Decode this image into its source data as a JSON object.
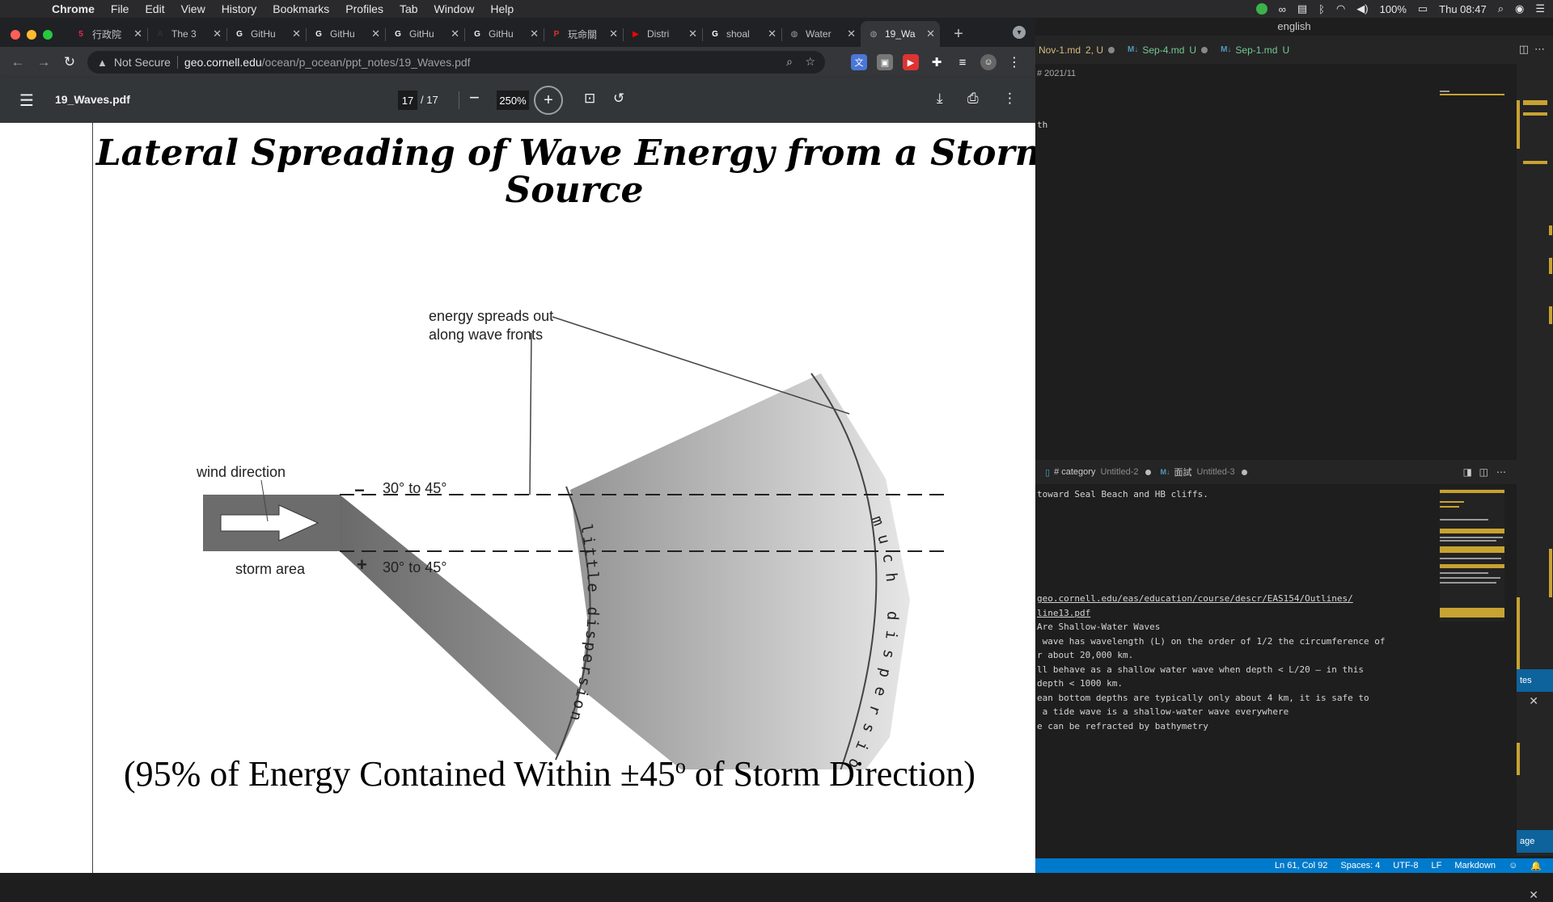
{
  "menubar": {
    "app": "Chrome",
    "items": [
      "File",
      "Edit",
      "View",
      "History",
      "Bookmarks",
      "Profiles",
      "Tab",
      "Window",
      "Help"
    ],
    "battery": "100%",
    "clock": "Thu 08:47"
  },
  "browser": {
    "tabs": [
      {
        "label": "行政院",
        "fav": "5",
        "fav_color": "#e52b50"
      },
      {
        "label": "The 3",
        "fav": "A",
        "fav_color": "#303134"
      },
      {
        "label": "GitHu",
        "fav": "G",
        "fav_color": "#f1f1f1"
      },
      {
        "label": "GitHu",
        "fav": "G",
        "fav_color": "#f1f1f1"
      },
      {
        "label": "GitHu",
        "fav": "G",
        "fav_color": "#f1f1f1"
      },
      {
        "label": "GitHu",
        "fav": "G",
        "fav_color": "#f1f1f1"
      },
      {
        "label": "玩命關",
        "fav": "P",
        "fav_color": "#e32d2d"
      },
      {
        "label": "Distri",
        "fav": "▶",
        "fav_color": "#ff0000"
      },
      {
        "label": "shoal",
        "fav": "G",
        "fav_color": "#ffffff"
      },
      {
        "label": "Water",
        "fav": "◍",
        "fav_color": "#9aa0a6"
      },
      {
        "label": "19_Wa",
        "fav": "◍",
        "fav_color": "#9aa0a6"
      }
    ],
    "security": "Not Secure",
    "url_host": "geo.cornell.edu",
    "url_path": "/ocean/p_ocean/ppt_notes/19_Waves.pdf"
  },
  "pdf": {
    "filename": "19_Waves.pdf",
    "page_current": "17",
    "page_total": "/ 17",
    "zoom": "250%"
  },
  "slide": {
    "title": "Lateral Spreading of Wave Energy from a Storm Source",
    "label_energy_1": "energy spreads out",
    "label_energy_2": "along wave fronts",
    "label_wind": "wind direction",
    "label_storm": "storm area",
    "label_angle_top": "30° to 45°",
    "label_angle_bottom": "30° to 45°",
    "label_minus": "−",
    "label_plus": "+",
    "label_little": "little dispersion",
    "label_much": "much dispersion",
    "caption_a": "(95% of Energy Contained Within ±45",
    "caption_sup": "o",
    "caption_b": " of Storm Direction)"
  },
  "vscode": {
    "title": "english",
    "tabs": [
      {
        "name": "Nov-1.md",
        "meta": "2, U"
      },
      {
        "name": "Sep-4.md",
        "meta": "U"
      },
      {
        "name": "Sep-1.md",
        "meta": "U"
      }
    ],
    "breadcrumb": "# 2021/11",
    "top_line": "th",
    "split_tabs": [
      {
        "name": "# category",
        "sub": "Untitled-2"
      },
      {
        "name": "面試",
        "sub": "Untitled-3"
      }
    ],
    "lines": [
      "toward Seal Beach and HB cliffs.",
      "geo.cornell.edu/eas/education/course/descr/EAS154/Outlines/",
      "line13.pdf",
      "Are Shallow-Water Waves",
      " wave has wavelength (L) on the order of 1/2 the circumference of",
      "r about 20,000 km.",
      "ll behave as a shallow water wave when depth < L/20 – in this",
      "depth < 1000 km.",
      "ean bottom depths are typically only about 4 km, it is safe to",
      " a tide wave is a shallow-water wave everywhere",
      "e can be refracted by bathymetry"
    ],
    "panel_btn_1": "tes",
    "panel_btn_2": "age",
    "status": {
      "position": "Ln 61, Col 92",
      "spaces": "Spaces: 4",
      "encoding": "UTF-8",
      "eol": "LF",
      "language": "Markdown"
    }
  }
}
